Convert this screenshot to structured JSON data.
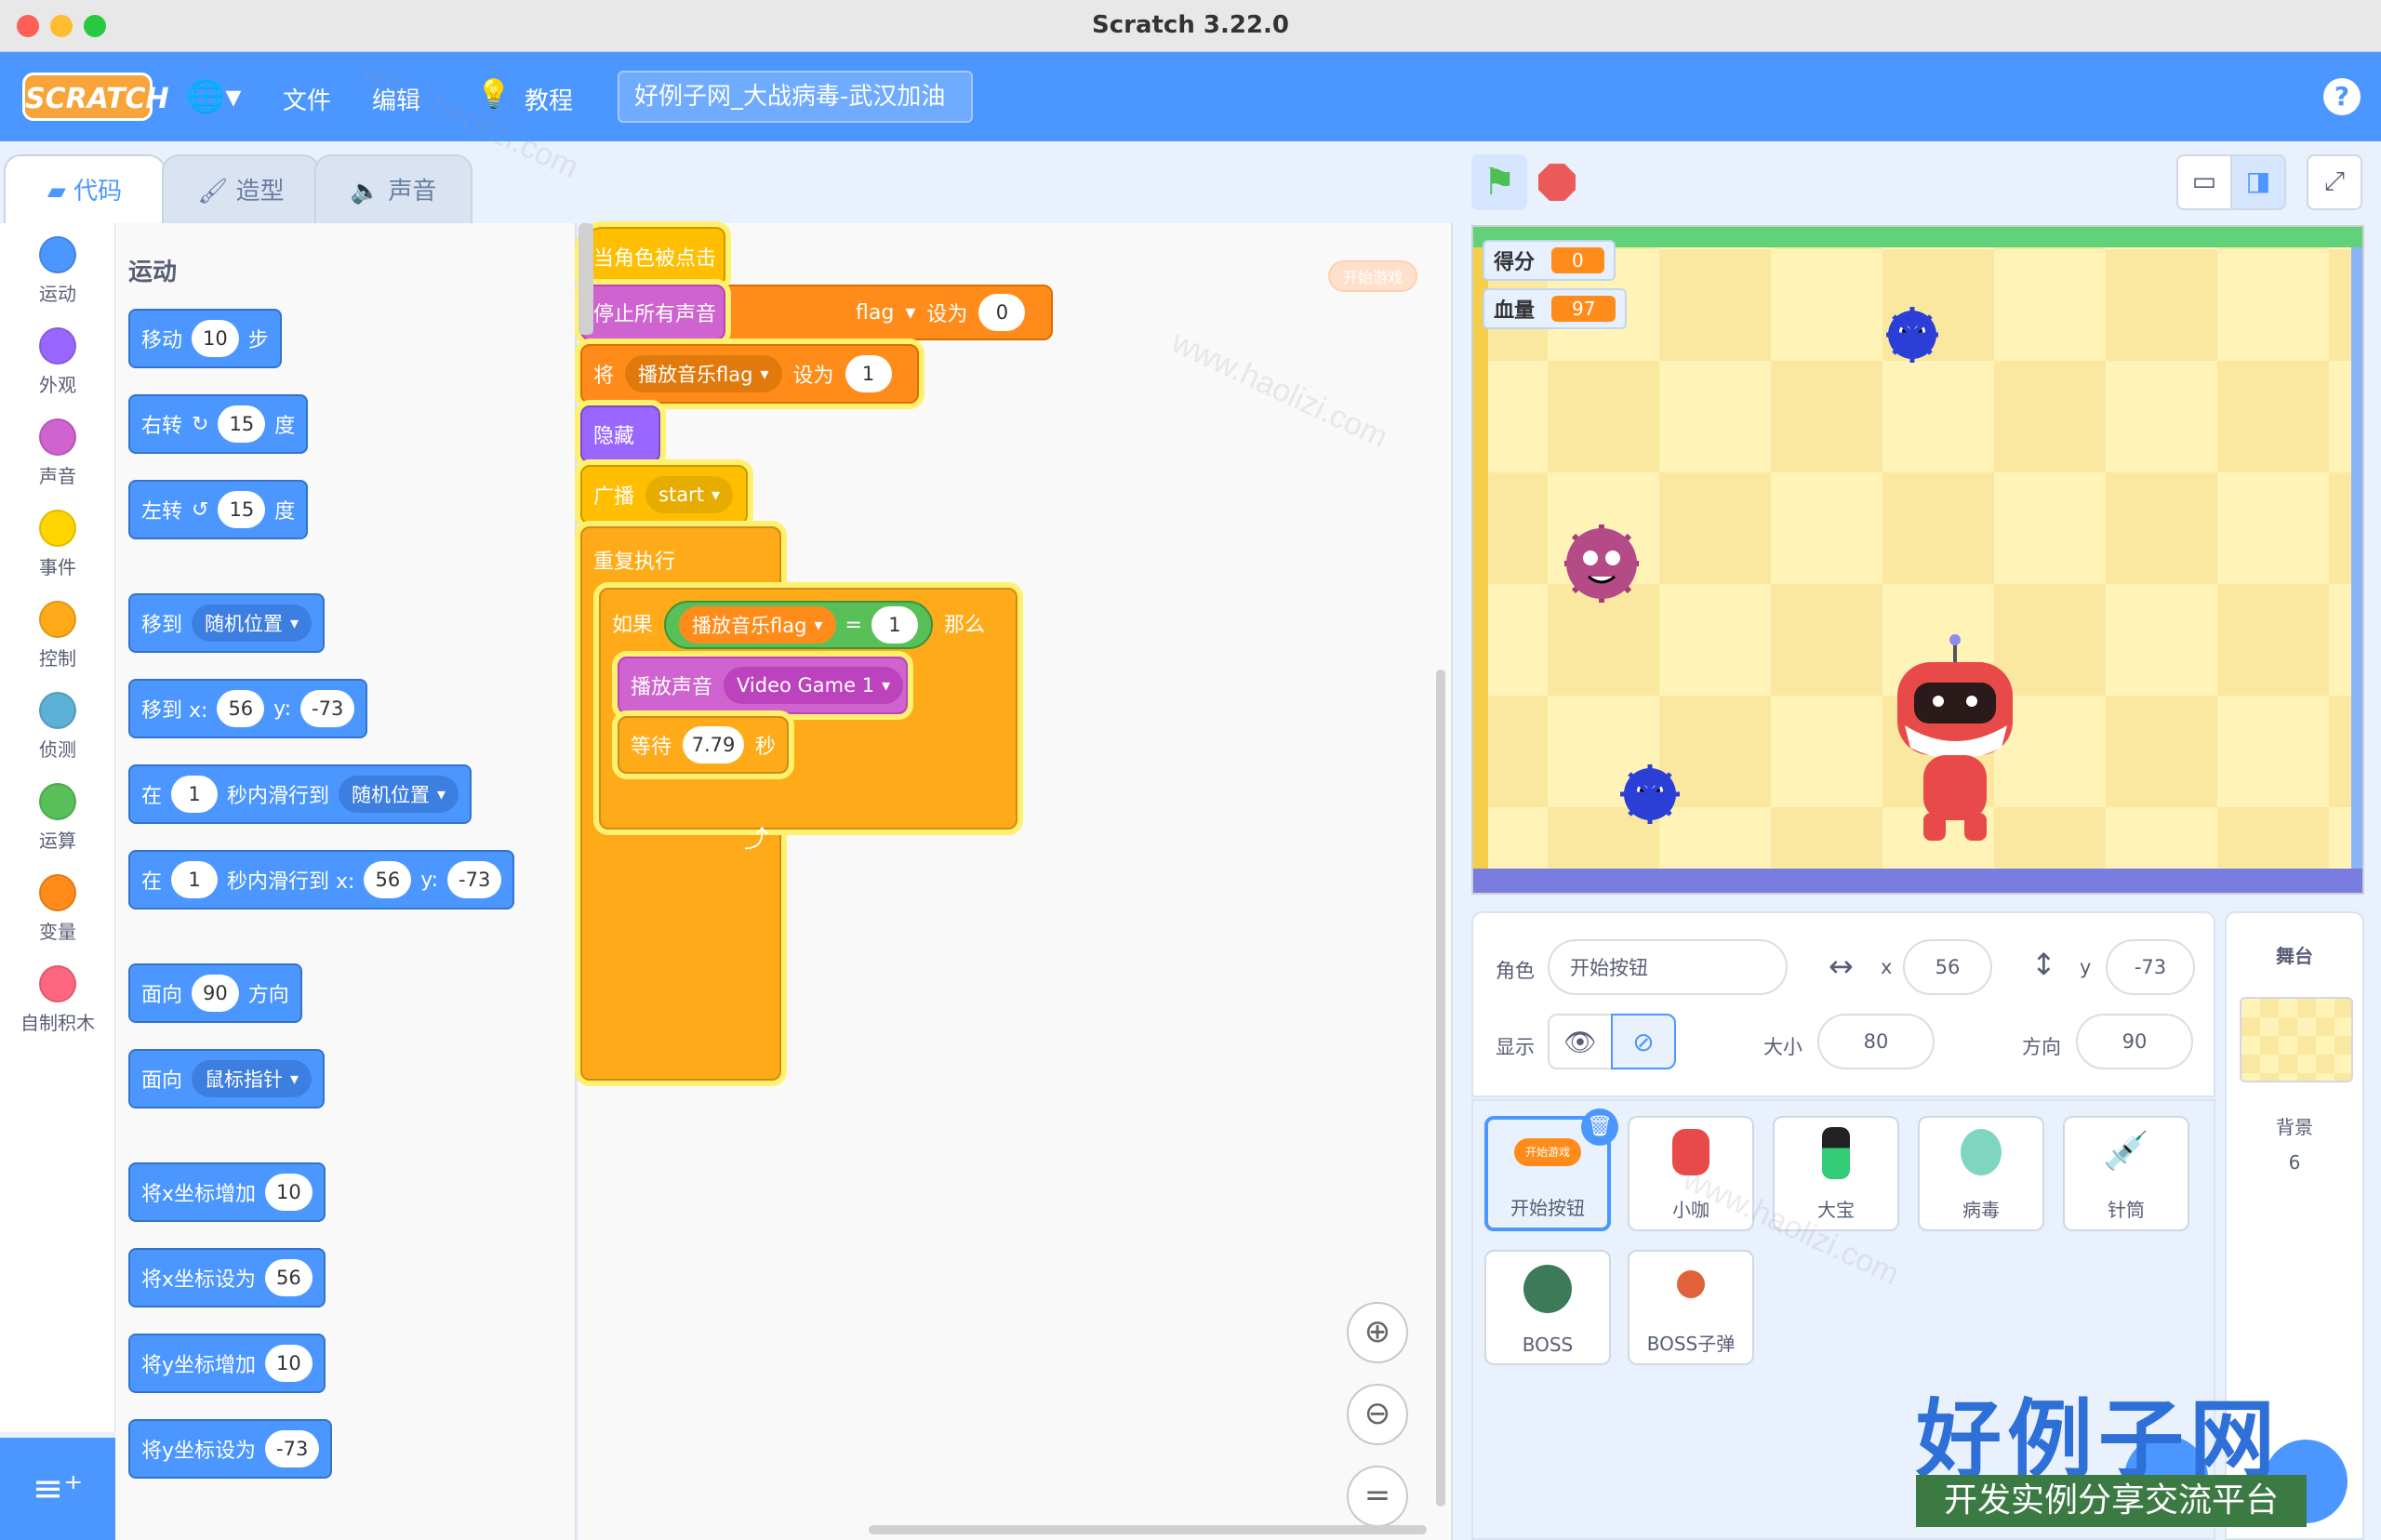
{
  "window": {
    "title": "Scratch 3.22.0"
  },
  "menubar": {
    "logo": "SCRATCH",
    "file": "文件",
    "edit": "编辑",
    "tutorials": "教程",
    "project_title": "好例子网_大战病毒-武汉加油",
    "help": "?"
  },
  "tabs": {
    "code": "代码",
    "costumes": "造型",
    "sounds": "声音"
  },
  "categories": [
    {
      "label": "运动",
      "color": "#4c97ff"
    },
    {
      "label": "外观",
      "color": "#9966ff"
    },
    {
      "label": "声音",
      "color": "#cf63cf"
    },
    {
      "label": "事件",
      "color": "#ffd500"
    },
    {
      "label": "控制",
      "color": "#ffab19"
    },
    {
      "label": "侦测",
      "color": "#5cb1d6"
    },
    {
      "label": "运算",
      "color": "#59c059"
    },
    {
      "label": "变量",
      "color": "#ff8c1a"
    },
    {
      "label": "自制积木",
      "color": "#ff6680"
    }
  ],
  "palette": {
    "title": "运动",
    "move": {
      "a": "移动",
      "v": "10",
      "b": "步"
    },
    "turn_right": {
      "a": "右转",
      "v": "15",
      "b": "度"
    },
    "turn_left": {
      "a": "左转",
      "v": "15",
      "b": "度"
    },
    "goto": {
      "a": "移到",
      "dd": "随机位置"
    },
    "goto_xy": {
      "a": "移到 x:",
      "x": "56",
      "b": "y:",
      "y": "-73"
    },
    "glide": {
      "a": "在",
      "v": "1",
      "b": "秒内滑行到",
      "dd": "随机位置"
    },
    "glide_xy": {
      "a": "在",
      "v": "1",
      "b": "秒内滑行到 x:",
      "x": "56",
      "c": "y:",
      "y": "-73"
    },
    "point": {
      "a": "面向",
      "v": "90",
      "b": "方向"
    },
    "point_towards": {
      "a": "面向",
      "dd": "鼠标指针"
    },
    "change_x": {
      "a": "将x坐标增加",
      "v": "10"
    },
    "set_x": {
      "a": "将x坐标设为",
      "v": "56"
    },
    "change_y": {
      "a": "将y坐标增加",
      "v": "10"
    },
    "set_y": {
      "a": "将y坐标设为",
      "v": "-73"
    }
  },
  "script": {
    "hat": "当角色被点击",
    "stop_sounds": "停止所有声音",
    "hidden_set": {
      "var": "flag",
      "to": "设为",
      "v": "0"
    },
    "set1": {
      "a": "将",
      "var": "播放音乐flag",
      "b": "设为",
      "v": "1"
    },
    "hide": "隐藏",
    "broadcast": {
      "a": "广播",
      "msg": "start"
    },
    "forever": "重复执行",
    "if": {
      "a": "如果",
      "var": "播放音乐flag",
      "op": "=",
      "v": "1",
      "b": "那么"
    },
    "play": {
      "a": "播放声音",
      "snd": "Video Game 1"
    },
    "wait": {
      "a": "等待",
      "v": "7.79",
      "b": "秒"
    },
    "comment": "开始游戏"
  },
  "stage": {
    "score_label": "得分",
    "score": "0",
    "hp_label": "血量",
    "hp": "97"
  },
  "sprite_info": {
    "sprite_label": "角色",
    "sprite_name": "开始按钮",
    "x_label": "x",
    "x": "56",
    "y_label": "y",
    "y": "-73",
    "show_label": "显示",
    "size_label": "大小",
    "size": "80",
    "dir_label": "方向",
    "dir": "90"
  },
  "sprites": [
    {
      "name": "开始按钮",
      "thumb": "开始游戏"
    },
    {
      "name": "小咖"
    },
    {
      "name": "大宝"
    },
    {
      "name": "病毒"
    },
    {
      "name": "针筒"
    },
    {
      "name": "BOSS"
    },
    {
      "name": "BOSS子弹"
    }
  ],
  "stage_panel": {
    "title": "舞台",
    "backdrop_label": "背景",
    "backdrop_count": "6"
  },
  "watermark": {
    "site": "www.haolizi.com",
    "logo": "好例子网",
    "slogan": "开发实例分享交流平台"
  }
}
